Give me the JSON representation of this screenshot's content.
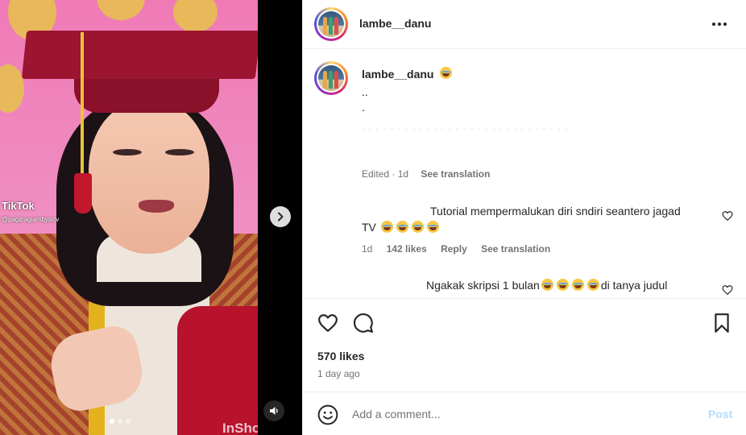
{
  "media": {
    "watermark_tiktok": "TikTok",
    "watermark_handle": "@pagipagiambyartv",
    "watermark_inshot": "InShot",
    "carousel_dots": 3,
    "carousel_active": 1
  },
  "post_header": {
    "username": "lambe__danu"
  },
  "caption": {
    "username": "lambe__danu",
    "line1": "..",
    "line2": ".",
    "edited": "Edited",
    "time": "1d",
    "see_translation": "See translation"
  },
  "comments": [
    {
      "text_line1": "Tutorial mempermalukan diri sndiri seantero jagad",
      "text_line2": "TV",
      "time": "1d",
      "likes": "142 likes",
      "reply": "Reply",
      "see_translation": "See translation"
    },
    {
      "text_part1": "Ngakak skripsi 1 bulan",
      "text_part2": "di tanya judul"
    }
  ],
  "actions": {
    "likes": "570 likes",
    "time": "1 day ago"
  },
  "composer": {
    "placeholder": "Add a comment...",
    "post_label": "Post"
  },
  "colors": {
    "post_disabled": "#b3dbff",
    "muted_text": "#737373"
  }
}
